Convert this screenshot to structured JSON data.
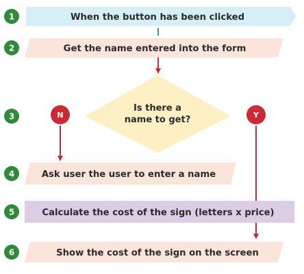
{
  "steps": [
    {
      "number": "1",
      "text": "When the button has been clicked"
    },
    {
      "number": "2",
      "text": "Get the name entered into the form"
    },
    {
      "number": "3"
    },
    {
      "number": "4",
      "text": "Ask user the user to enter a name"
    },
    {
      "number": "5",
      "text": "Calculate the cost of the sign (letters x price)"
    },
    {
      "number": "6",
      "text": "Show the cost of the sign on the screen"
    }
  ],
  "decision": {
    "line1": "Is there a",
    "line2": "name to get?"
  },
  "branches": {
    "no": "N",
    "yes": "Y"
  },
  "colors": {
    "step_circle": "#2f8a3a",
    "step1_fill": "#d6eef5",
    "step2_fill": "#fbe5db",
    "decision_fill": "#fdf0c4",
    "step4_fill": "#fbe5db",
    "step5_fill": "#dccde5",
    "step6_fill": "#fbe5db",
    "branch_circle": "#cc2a36",
    "connector": "#c02a3a",
    "connector_blue": "#2a8fc2"
  }
}
